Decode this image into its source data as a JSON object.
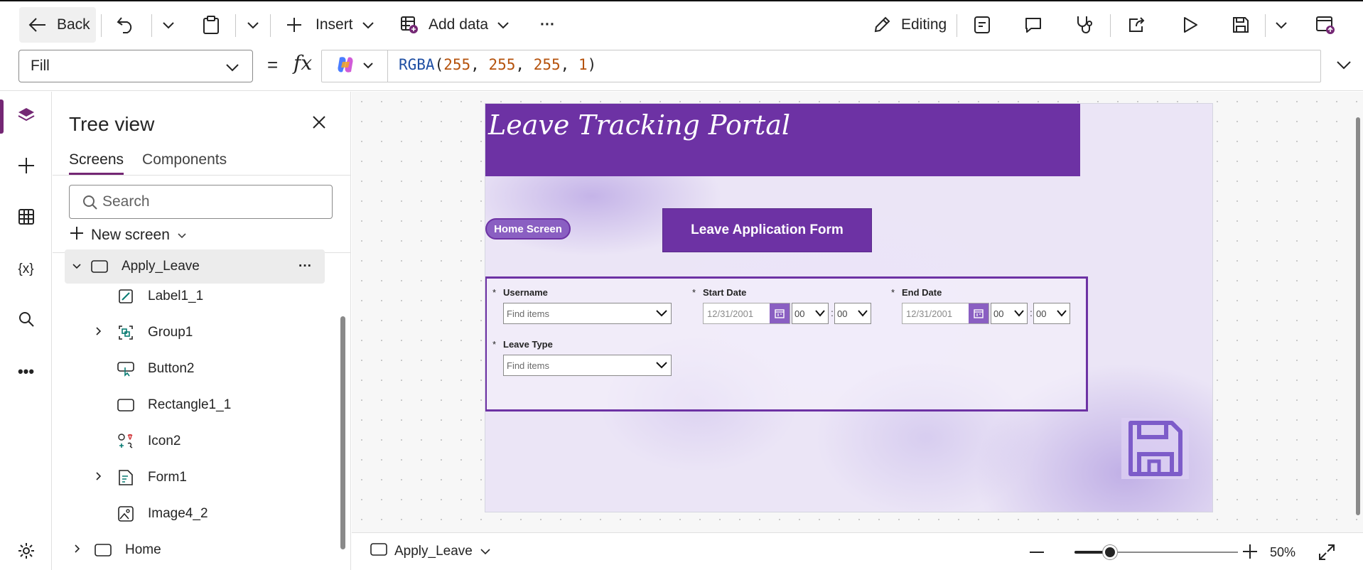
{
  "toolbar": {
    "back": "Back",
    "insert": "Insert",
    "add_data": "Add data",
    "more": "···",
    "editing": "Editing"
  },
  "formula_bar": {
    "property": "Fill",
    "equals": "=",
    "fx": "fx",
    "fn": "RGBA",
    "open": "(",
    "args": [
      "255",
      "255",
      "255",
      "1"
    ],
    "sep": ", ",
    "close": ")"
  },
  "tree_view": {
    "title": "Tree view",
    "tabs": [
      "Screens",
      "Components"
    ],
    "search_placeholder": "Search",
    "new_screen": "New screen",
    "screen_name": "Apply_Leave",
    "children": [
      {
        "label": "Label1_1",
        "icon": "label-icon",
        "expandable": false
      },
      {
        "label": "Group1",
        "icon": "group-icon",
        "expandable": true
      },
      {
        "label": "Button2",
        "icon": "button-icon",
        "expandable": false
      },
      {
        "label": "Rectangle1_1",
        "icon": "rectangle-icon",
        "expandable": false
      },
      {
        "label": "Icon2",
        "icon": "icons-icon",
        "expandable": false
      },
      {
        "label": "Form1",
        "icon": "form-icon",
        "expandable": true
      },
      {
        "label": "Image4_2",
        "icon": "image-icon",
        "expandable": false
      }
    ],
    "home_screen": "Home"
  },
  "canvas": {
    "header_title": "Leave Tracking Portal",
    "home_button": "Home Screen",
    "form_title_button": "Leave Application Form",
    "form": {
      "username_label": "Username",
      "username_placeholder": "Find items",
      "start_date_label": "Start Date",
      "start_date_value": "12/31/2001",
      "start_hour": "00",
      "start_minute": "00",
      "end_date_label": "End Date",
      "end_date_value": "12/31/2001",
      "end_hour": "00",
      "end_minute": "00",
      "leave_type_label": "Leave Type",
      "leave_type_placeholder": "Find items",
      "required_marker": "*",
      "time_separator": ":"
    }
  },
  "bottom_bar": {
    "screen_name": "Apply_Leave",
    "zoom_label": "50%",
    "zoom_value": 0.5
  },
  "colors": {
    "brand": "#742774",
    "header_purple": "#6d32a4",
    "button_purple": "#6d32a4",
    "pill_purple": "#8a5fc2"
  }
}
